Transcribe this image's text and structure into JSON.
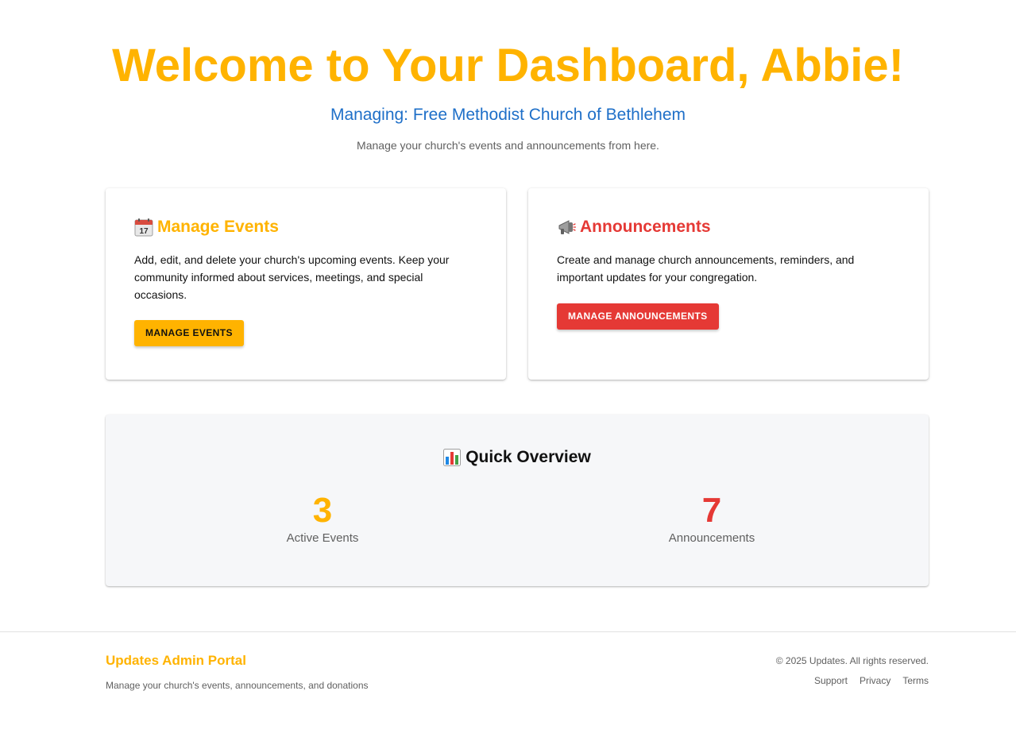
{
  "hero": {
    "title": "Welcome to Your Dashboard, Abbie!",
    "subtitle": "Managing: Free Methodist Church of Bethlehem",
    "description": "Manage your church's events and announcements from here."
  },
  "cards": {
    "events": {
      "icon": "calendar-icon",
      "title": "Manage Events",
      "description": "Add, edit, and delete your church's upcoming events. Keep your community informed about services, meetings, and special occasions.",
      "button_label": "MANAGE EVENTS"
    },
    "announcements": {
      "icon": "megaphone-icon",
      "title": "Announcements",
      "description": "Create and manage church announcements, reminders, and important updates for your congregation.",
      "button_label": "MANAGE ANNOUNCEMENTS"
    }
  },
  "overview": {
    "icon": "bar-chart-icon",
    "title": "Quick Overview",
    "stats": [
      {
        "value": "3",
        "label": "Active Events"
      },
      {
        "value": "7",
        "label": "Announcements"
      }
    ]
  },
  "footer": {
    "brand": "Updates Admin Portal",
    "tagline": "Manage your church's events, announcements, and donations",
    "copyright": "© 2025 Updates. All rights reserved.",
    "links": [
      "Support",
      "Privacy",
      "Terms"
    ]
  },
  "colors": {
    "accent_amber": "#FFB300",
    "accent_red": "#E53935",
    "subtitle_blue": "#1E6FC8",
    "muted_text": "#606060"
  }
}
